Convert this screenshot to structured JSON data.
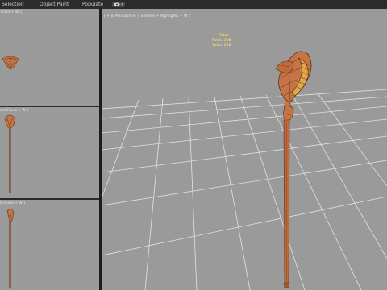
{
  "menu": {
    "items": [
      "Selection",
      "Object Paint",
      "Populate"
    ]
  },
  "viewports": {
    "top": {
      "label": "Front + W ]"
    },
    "mid": {
      "label": "ont Fiuna + W ]"
    },
    "bottom": {
      "label": "t Feuna + W ]"
    },
    "main": {
      "label": "[ + ][ Perspective ][ Smooth + Highlights + W ]"
    }
  },
  "stats": {
    "title": "Total",
    "polys_label": "Polys:",
    "polys_value": "298",
    "verts_label": "Verts:",
    "verts_value": "298"
  },
  "colors": {
    "model_orange": "#c57545",
    "model_dark": "#6b3a1f",
    "hood_yellow": "#e0a845",
    "viewport_bg": "#9a9a9a",
    "grid": "#e2e2e2",
    "stats_text": "#ffe65c"
  }
}
